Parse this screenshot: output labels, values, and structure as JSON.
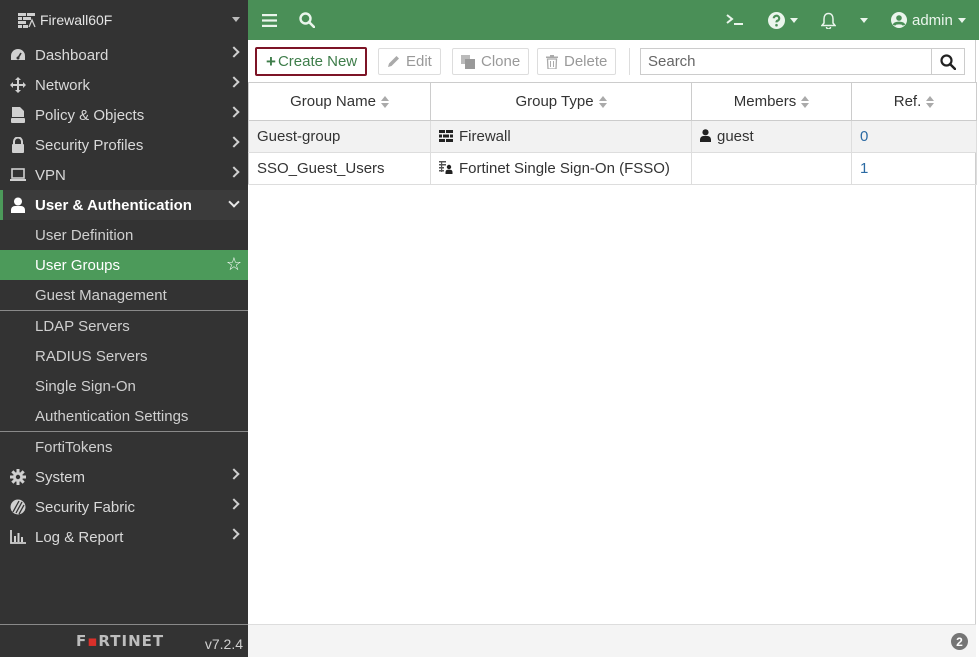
{
  "sidebar": {
    "device_name": "Firewall60F",
    "nav": [
      {
        "label": "Dashboard",
        "icon": "dashboard-icon"
      },
      {
        "label": "Network",
        "icon": "network-icon"
      },
      {
        "label": "Policy & Objects",
        "icon": "policy-icon"
      },
      {
        "label": "Security Profiles",
        "icon": "lock-icon"
      },
      {
        "label": "VPN",
        "icon": "laptop-icon"
      },
      {
        "label": "User & Authentication",
        "icon": "user-icon",
        "expanded": true
      }
    ],
    "sub_items": [
      {
        "label": "User Definition"
      },
      {
        "label": "User Groups",
        "active": true
      },
      {
        "label": "Guest Management"
      },
      {
        "label": "LDAP Servers"
      },
      {
        "label": "RADIUS Servers"
      },
      {
        "label": "Single Sign-On"
      },
      {
        "label": "Authentication Settings"
      },
      {
        "label": "FortiTokens"
      }
    ],
    "nav_bottom": [
      {
        "label": "System",
        "icon": "gear-icon"
      },
      {
        "label": "Security Fabric",
        "icon": "fabric-icon"
      },
      {
        "label": "Log & Report",
        "icon": "chart-icon"
      }
    ],
    "logo_text_pre": "F",
    "logo_text_o": "▪",
    "logo_text_post": "RTINET",
    "version": "v7.2.4"
  },
  "topbar": {
    "admin_label": "admin"
  },
  "toolbar": {
    "create_label": "Create New",
    "edit_label": "Edit",
    "clone_label": "Clone",
    "delete_label": "Delete",
    "search_placeholder": "Search"
  },
  "table": {
    "columns": [
      "Group Name",
      "Group Type",
      "Members",
      "Ref."
    ],
    "rows": [
      {
        "name": "Guest-group",
        "type": "Firewall",
        "type_icon": "firewall-icon",
        "members": "guest",
        "ref": "0"
      },
      {
        "name": "SSO_Guest_Users",
        "type": "Fortinet Single Sign-On (FSSO)",
        "type_icon": "fsso-icon",
        "members": "",
        "ref": "1"
      }
    ]
  },
  "status": {
    "count": "2"
  },
  "colors": {
    "sidebar_bg": "#333333",
    "accent_green": "#4a8f57",
    "active_item": "#4c9a5a",
    "create_border": "#7d1426",
    "link_blue": "#2b6aa3"
  }
}
